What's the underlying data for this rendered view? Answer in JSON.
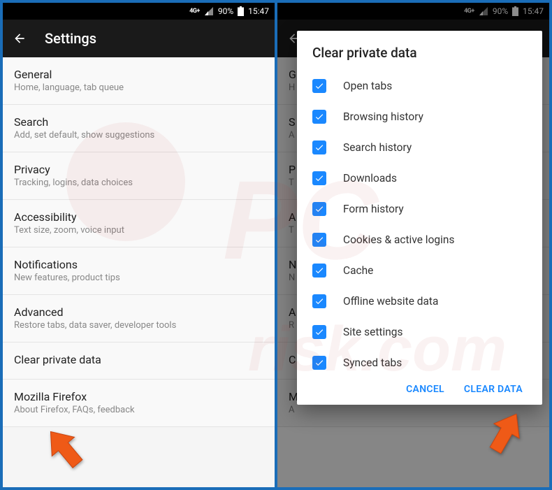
{
  "status": {
    "network": "4G+",
    "battery_pct": "90%",
    "time": "15:47"
  },
  "left": {
    "title": "Settings",
    "items": [
      {
        "primary": "General",
        "secondary": "Home, language, tab queue"
      },
      {
        "primary": "Search",
        "secondary": "Add, set default, show suggestions"
      },
      {
        "primary": "Privacy",
        "secondary": "Tracking, logins, data choices"
      },
      {
        "primary": "Accessibility",
        "secondary": "Text size, zoom, voice input"
      },
      {
        "primary": "Notifications",
        "secondary": "New features, product tips"
      },
      {
        "primary": "Advanced",
        "secondary": "Restore tabs, data saver, developer tools"
      },
      {
        "primary": "Clear private data",
        "secondary": ""
      },
      {
        "primary": "Mozilla Firefox",
        "secondary": "About Firefox, FAQs, feedback"
      }
    ]
  },
  "right_bg": {
    "items": [
      {
        "primary": "G",
        "secondary": "H"
      },
      {
        "primary": "S",
        "secondary": "A"
      },
      {
        "primary": "P",
        "secondary": "T"
      },
      {
        "primary": "A",
        "secondary": "T"
      },
      {
        "primary": "N",
        "secondary": "N"
      },
      {
        "primary": "A",
        "secondary": "R"
      },
      {
        "primary": "C",
        "secondary": ""
      },
      {
        "primary": "M",
        "secondary": "A"
      }
    ]
  },
  "dialog": {
    "title": "Clear private data",
    "options": [
      "Open tabs",
      "Browsing history",
      "Search history",
      "Downloads",
      "Form history",
      "Cookies & active logins",
      "Cache",
      "Offline website data",
      "Site settings",
      "Synced tabs"
    ],
    "cancel": "CANCEL",
    "confirm": "CLEAR DATA"
  },
  "colors": {
    "accent": "#1a88ff",
    "arrow": "#ef5a17"
  }
}
